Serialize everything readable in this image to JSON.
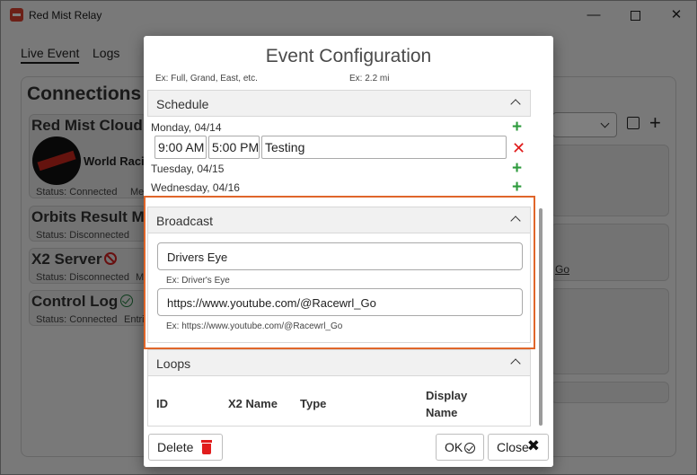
{
  "app": {
    "title": "Red Mist Relay",
    "tabs": [
      {
        "label": "Live Event"
      },
      {
        "label": "Logs"
      }
    ],
    "connections_heading": "Connections",
    "cards": [
      {
        "title": "Red Mist Cloud",
        "org_name": "World Racing",
        "status": "Status: Connected",
        "extra": "Me"
      },
      {
        "title": "Orbits Result Mo",
        "status": "Status: Disconnected"
      },
      {
        "title": "X2 Server",
        "status": "Status: Disconnected",
        "extra": "M"
      },
      {
        "title": "Control Log",
        "status": "Status: Connected",
        "extra": "Entri"
      }
    ],
    "right_link_fragment": "Go"
  },
  "modal": {
    "title": "Event Configuration",
    "hints": {
      "track_type": "Ex: Full, Grand, East, etc.",
      "track_length": "Ex: 2.2 mi"
    },
    "schedule": {
      "label": "Schedule",
      "days": [
        {
          "label": "Monday, 04/14"
        },
        {
          "label": "Tuesday, 04/15"
        },
        {
          "label": "Wednesday, 04/16"
        }
      ],
      "entry": {
        "start": "9:00 AM",
        "end": "5:00 PM",
        "description": "Testing"
      }
    },
    "broadcast": {
      "label": "Broadcast",
      "name_value": "Drivers Eye",
      "name_hint": "Ex: Driver's Eye",
      "url_value": "https://www.youtube.com/@Racewrl_Go",
      "url_hint": "Ex: https://www.youtube.com/@Racewrl_Go"
    },
    "loops": {
      "label": "Loops",
      "columns": {
        "id": "ID",
        "x2_name": "X2 Name",
        "type": "Type",
        "display_name": "Display Name"
      }
    },
    "buttons": {
      "delete": "Delete",
      "ok": "OK",
      "close": "Close"
    }
  },
  "colors": {
    "accent_highlight": "#e0662a",
    "add_green": "#2e9b3d",
    "remove_red": "#e01b1b"
  }
}
